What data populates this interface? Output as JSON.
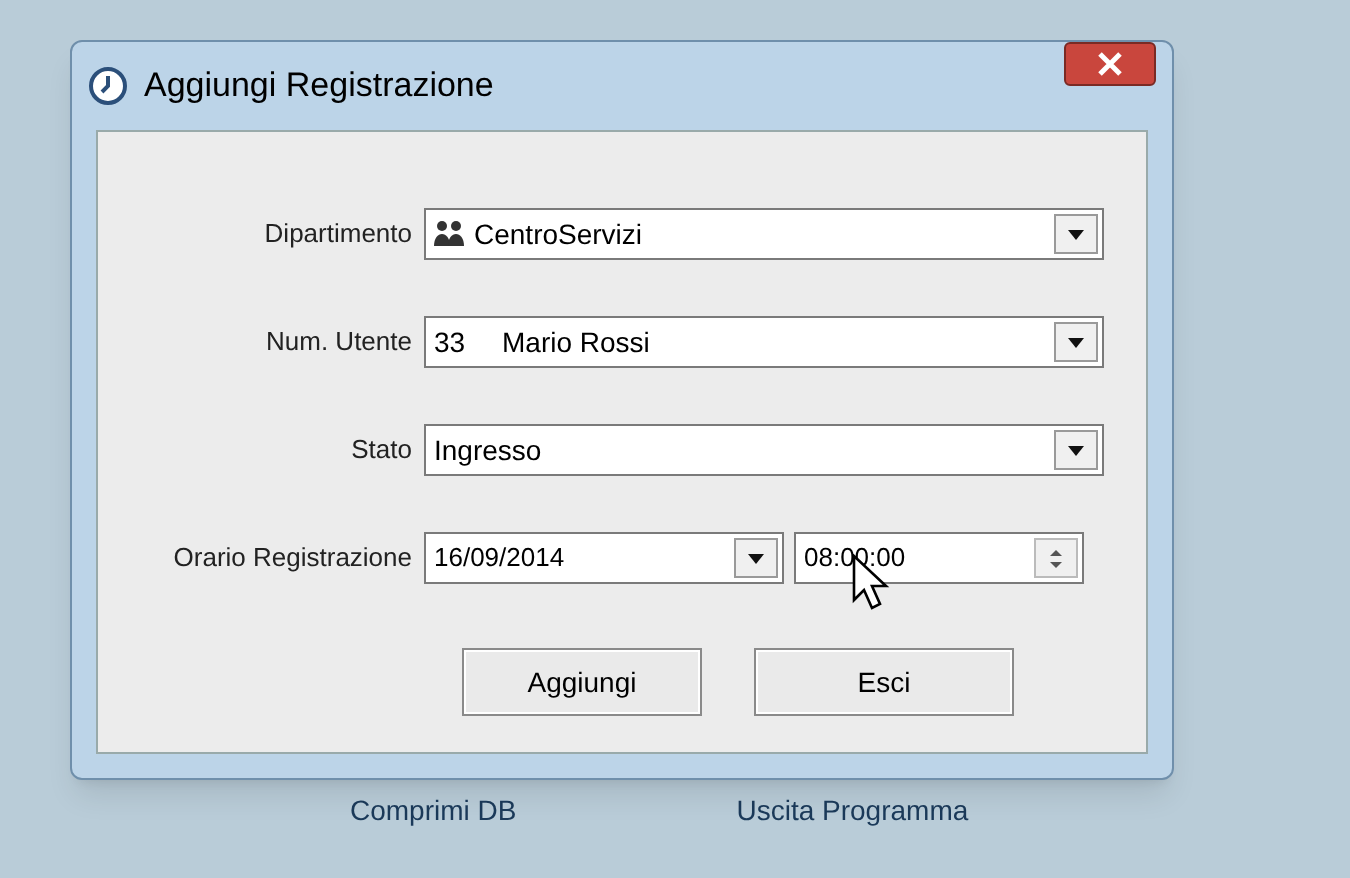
{
  "window": {
    "title": "Aggiungi Registrazione"
  },
  "fields": [
    {
      "label": "Dipartimento",
      "kind": "group_select",
      "value": "CentroServizi"
    },
    {
      "label": "Num. Utente",
      "kind": "select",
      "code": "33",
      "value": "Mario Rossi"
    },
    {
      "label": "Stato",
      "kind": "select",
      "value": "Ingresso"
    },
    {
      "label": "Orario Registrazione",
      "kind": "datetime",
      "date": "16/09/2014",
      "time": "08:00:00"
    }
  ],
  "buttons": [
    "Aggiungi",
    "Esci"
  ],
  "background_items": [
    "Comprimi DB",
    "Uscita Programma"
  ]
}
